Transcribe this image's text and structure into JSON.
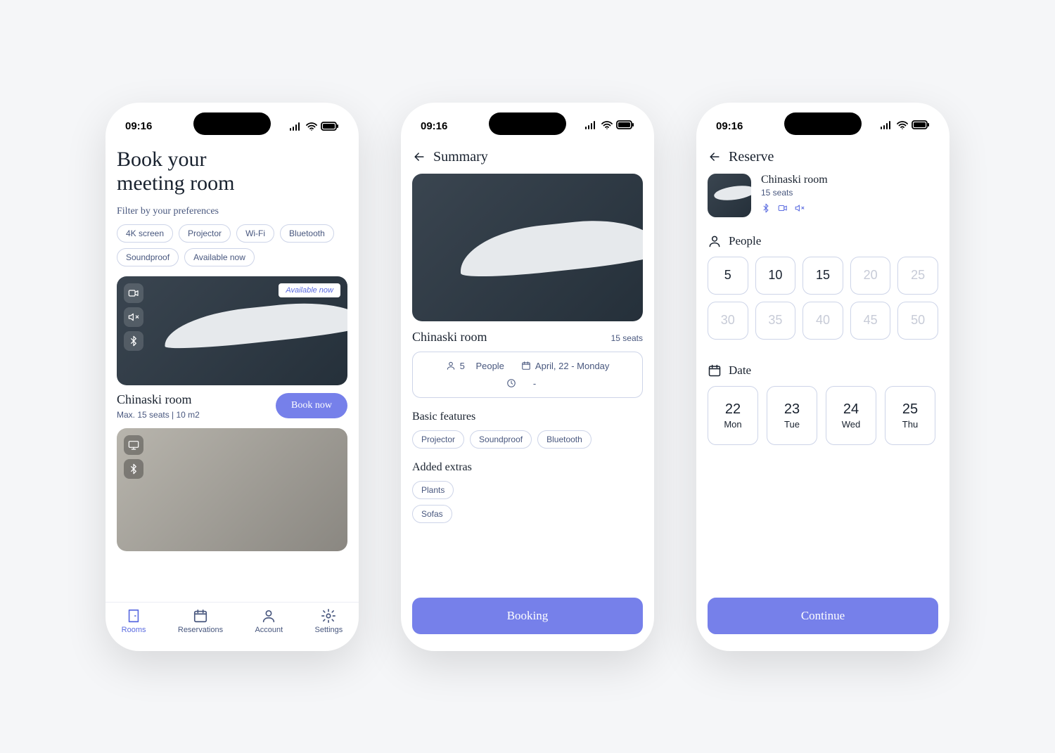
{
  "status": {
    "time": "09:16"
  },
  "screen1": {
    "title_line1": "Book your",
    "title_line2": "meeting room",
    "filter_label": "Filter by your preferences",
    "filters": [
      "4K screen",
      "Projector",
      "Wi-Fi",
      "Bluetooth",
      "Soundproof",
      "Available now"
    ],
    "room1": {
      "badge": "Available now",
      "name": "Chinaski room",
      "sub": "Max. 15 seats  |  10 m2",
      "book_btn": "Book now"
    },
    "tabs": {
      "rooms": "Rooms",
      "reservations": "Reservations",
      "account": "Account",
      "settings": "Settings"
    }
  },
  "screen2": {
    "header": "Summary",
    "room_name": "Chinaski room",
    "seats": "15 seats",
    "people_count": "5",
    "people_label": "People",
    "date": "April, 22 - Monday",
    "time": "-",
    "basic_title": "Basic features",
    "basic": [
      "Projector",
      "Soundproof",
      "Bluetooth"
    ],
    "extras_title": "Added extras",
    "extras": [
      "Plants",
      "Sofas"
    ],
    "cta": "Booking"
  },
  "screen3": {
    "header": "Reserve",
    "room_name": "Chinaski room",
    "seats": "15 seats",
    "people_title": "People",
    "people": [
      {
        "v": "5",
        "d": false
      },
      {
        "v": "10",
        "d": false
      },
      {
        "v": "15",
        "d": false
      },
      {
        "v": "20",
        "d": true
      },
      {
        "v": "25",
        "d": true
      },
      {
        "v": "30",
        "d": true
      },
      {
        "v": "35",
        "d": true
      },
      {
        "v": "40",
        "d": true
      },
      {
        "v": "45",
        "d": true
      },
      {
        "v": "50",
        "d": true
      }
    ],
    "date_title": "Date",
    "dates": [
      {
        "n": "22",
        "d": "Mon"
      },
      {
        "n": "23",
        "d": "Tue"
      },
      {
        "n": "24",
        "d": "Wed"
      },
      {
        "n": "25",
        "d": "Thu"
      }
    ],
    "cta": "Continue"
  }
}
